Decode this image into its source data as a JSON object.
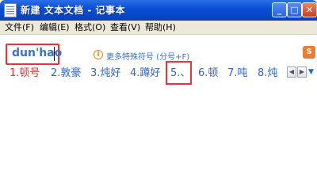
{
  "window": {
    "title": "新建 文本文档 - 记事本",
    "minimize_glyph": "_",
    "maximize_glyph": "□",
    "close_glyph": "✕",
    "icon": "notepad-icon"
  },
  "menu": [
    "文件(F)",
    "编辑(E)",
    "格式(O)",
    "查看(V)",
    "帮助(H)"
  ],
  "ime": {
    "pinyin": "dun'hao",
    "more_symbols": "更多特殊符号 (分号+F)",
    "info_glyph": "i",
    "candidates": [
      "1.顿号",
      "2.敦豪",
      "3.炖好",
      "4.蹲好",
      "5.、",
      "6.顿",
      "7.吨",
      "8.炖"
    ],
    "prev_glyph": "◀",
    "next_glyph": "▶",
    "logo_glyph": "S",
    "expand_glyph": "▼",
    "highlight_color": "#e8333b",
    "candidate_color": "#2f66c2"
  }
}
